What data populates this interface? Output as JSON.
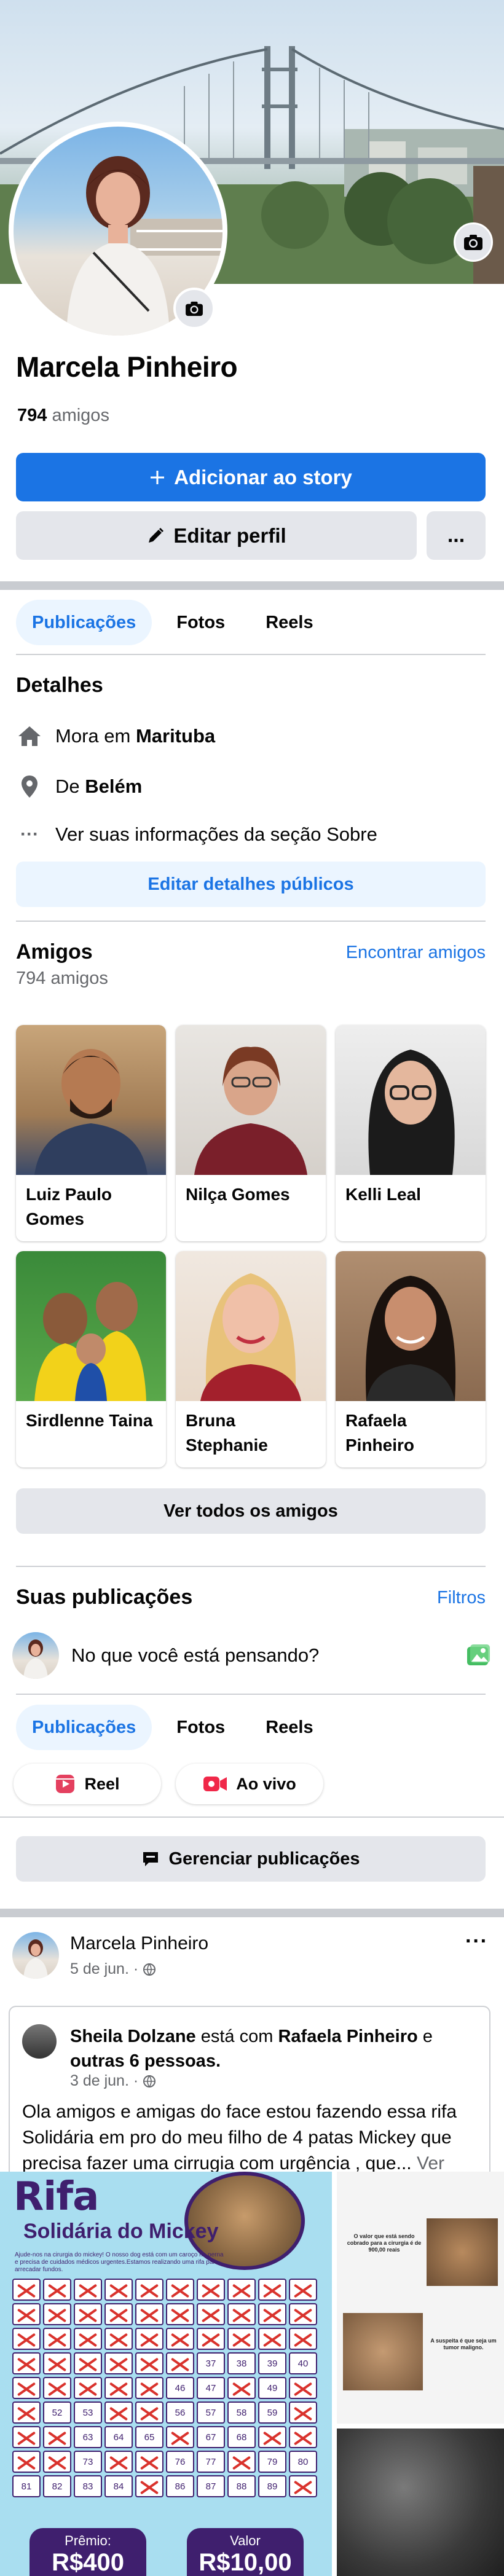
{
  "profile": {
    "name": "Marcela Pinheiro",
    "friends_count": "794",
    "friends_word": "amigos"
  },
  "actions": {
    "add_story": "Adicionar ao story",
    "edit_profile": "Editar perfil",
    "more": "..."
  },
  "tabs": [
    "Publicações",
    "Fotos",
    "Reels"
  ],
  "details": {
    "title": "Detalhes",
    "lives_prefix": "Mora em",
    "lives_city": "Marituba",
    "from_prefix": "De",
    "from_city": "Belém",
    "about": "Ver suas informações da seção Sobre",
    "edit_button": "Editar detalhes públicos"
  },
  "friends": {
    "title": "Amigos",
    "count_label": "794 amigos",
    "find_link": "Encontrar amigos",
    "see_all": "Ver todos os amigos",
    "items": [
      {
        "name": "Luiz Paulo Gomes"
      },
      {
        "name": "Nilça Gomes"
      },
      {
        "name": "Kelli Leal"
      },
      {
        "name": "Sirdlenne Taina"
      },
      {
        "name": "Bruna Stephanie"
      },
      {
        "name": "Rafaela Pinheiro"
      }
    ]
  },
  "posts_section": {
    "title": "Suas publicações",
    "filters": "Filtros",
    "composer_placeholder": "No que você está pensando?",
    "reel": "Reel",
    "live": "Ao vivo",
    "manage": "Gerenciar publicações"
  },
  "post": {
    "author": "Marcela Pinheiro",
    "date": "5 de jun. ·",
    "more": "···",
    "shared_author": "Sheila Dolzane",
    "shared_with": "está com",
    "shared_tagged": "Rafaela Pinheiro",
    "shared_and": "e",
    "shared_others": "outras 6 pessoas.",
    "shared_date": "3 de jun. ·",
    "shared_text": "Ola amigos e amigas do face estou fazendo essa rifa Solidária em pro do meu filho de 4 patas Mickey que precisa fazer uma cirrugia com urgência , que...",
    "see_more": "Ver mais"
  },
  "rifa": {
    "title": "Rifa",
    "subtitle": "Solidária do Mickey",
    "description": "Ajude-nos na cirurgia do mickey! O nosso dog está com um caroço na perna e precisa de cuidados médicos urgentes.Estamos realizando uma rifa para arrecadar fundos.",
    "open_numbers": [
      "37",
      "38",
      "39",
      "40",
      "46",
      "47",
      "49",
      "52",
      "53",
      "56",
      "57",
      "58",
      "59",
      "63",
      "64",
      "65",
      "67",
      "68",
      "73",
      "76",
      "77",
      "79",
      "80",
      "81",
      "82",
      "83",
      "84",
      "86",
      "87",
      "88",
      "89"
    ],
    "prize_label": "Prêmio:",
    "prize_value": "R$400",
    "price_label": "Valor",
    "price_value": "R$10,00",
    "side_text_1": "O valor que está sendo cobrado para a cirurgia é de 900,00 reais",
    "side_text_2": "A suspeita é que seja um tumor maligno."
  },
  "colors": {
    "primary": "#1b74e4",
    "light_blue": "#ebf5ff",
    "gray_button": "#e4e6eb",
    "separator": "#c9ccd1",
    "secondary_text": "#65676b",
    "rifa_purple": "#3f1f6e",
    "rifa_bg": "#a9def0"
  }
}
